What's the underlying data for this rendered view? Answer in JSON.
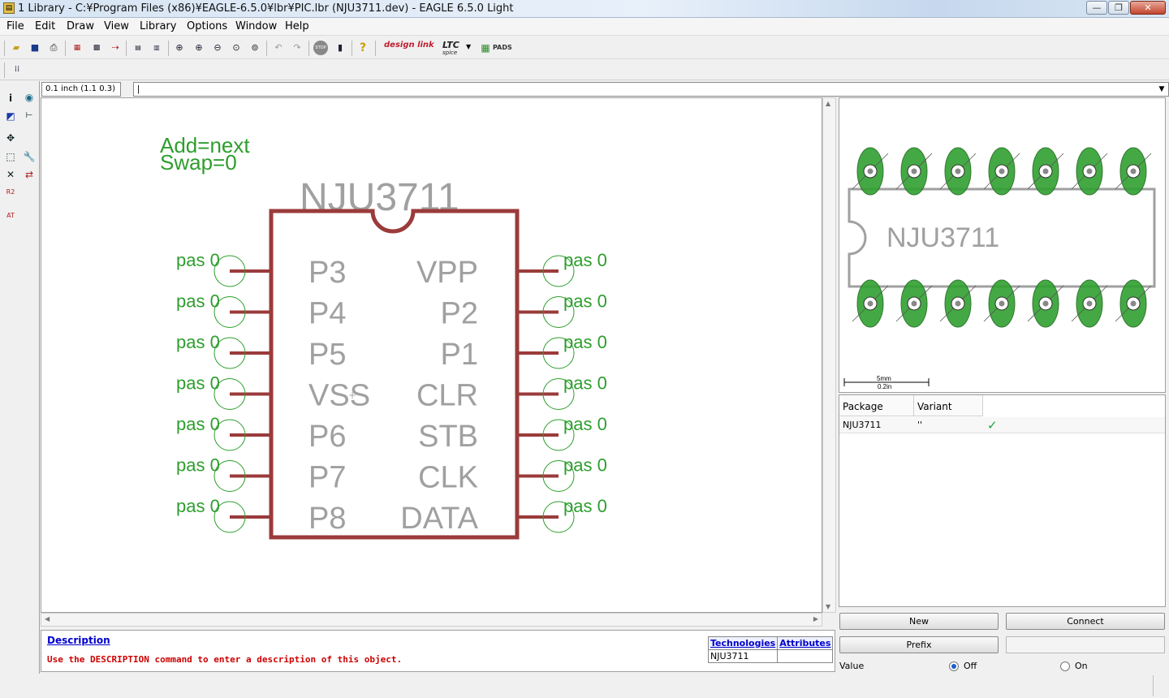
{
  "window": {
    "title": "1 Library - C:¥Program Files (x86)¥EAGLE-6.5.0¥lbr¥PIC.lbr (NJU3711.dev) - EAGLE 6.5.0 Light",
    "minimize": "—",
    "maximize": "❐",
    "close": "✕"
  },
  "menu": [
    {
      "label": "File",
      "name": "menu-file"
    },
    {
      "label": "Edit",
      "name": "menu-edit"
    },
    {
      "label": "Draw",
      "name": "menu-draw"
    },
    {
      "label": "View",
      "name": "menu-view"
    },
    {
      "label": "Library",
      "name": "menu-library"
    },
    {
      "label": "Options",
      "name": "menu-options"
    },
    {
      "label": "Window",
      "name": "menu-window"
    },
    {
      "label": "Help",
      "name": "menu-help"
    }
  ],
  "toolbar": {
    "design_link": "design link",
    "ltc": "LTC",
    "ltc_sub": "spice",
    "pads": "PADS",
    "stop": "STOP"
  },
  "command": {
    "grid_display": "0.1 inch (1.1 0.3)",
    "input_value": "|"
  },
  "canvas": {
    "add_label": "Add=next",
    "swap_label": "Swap=0",
    "device_name": "NJU3711",
    "pin_attr": "pas 0",
    "left_pins": [
      "P3",
      "P4",
      "P5",
      "VSS",
      "P6",
      "P7",
      "P8"
    ],
    "right_pins": [
      "VPP",
      "P2",
      "P1",
      "CLR",
      "STB",
      "CLK",
      "DATA"
    ]
  },
  "preview": {
    "package_name": "NJU3711",
    "scale_top": "5mm",
    "scale_bottom": "0.2in"
  },
  "package_table": {
    "headers": [
      "Package",
      "Variant"
    ],
    "rows": [
      {
        "package": "NJU3711",
        "variant": "''",
        "check": "✓"
      }
    ]
  },
  "description": {
    "link": "Description",
    "text": "Use the DESCRIPTION command to enter a description of this object."
  },
  "technologies": {
    "headers": [
      "Technologies",
      "Attributes"
    ],
    "rows": [
      [
        "NJU3711",
        ""
      ]
    ]
  },
  "buttons": {
    "new": "New",
    "connect": "Connect",
    "prefix": "Prefix"
  },
  "value_option": {
    "label": "Value",
    "off": "Off",
    "on": "On",
    "selected": "off"
  },
  "colors": {
    "symbol_outline": "#9b3b3b",
    "pin_label": "#a0a0a0",
    "attr_green": "#2e9e2e",
    "pad_green": "#30a030",
    "link_blue": "#0000cc",
    "desc_red": "#cc0000"
  }
}
